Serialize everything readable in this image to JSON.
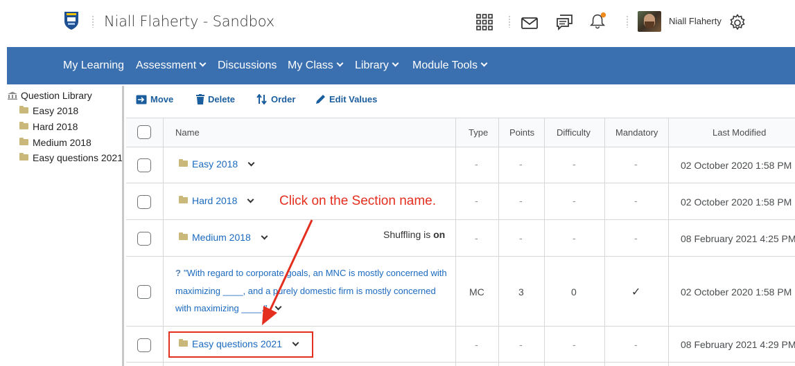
{
  "header": {
    "site_title": "Niall Flaherty - Sandbox",
    "user_name": "Niall Flaherty",
    "icons": [
      "app-grid-icon",
      "mail-icon",
      "chat-icon",
      "bell-icon",
      "gear-icon"
    ],
    "notification_color": "#f18a1d"
  },
  "nav": {
    "items": [
      {
        "label": "My Learning",
        "has_menu": false
      },
      {
        "label": "Assessment",
        "has_menu": true
      },
      {
        "label": "Discussions",
        "has_menu": false
      },
      {
        "label": "My Class",
        "has_menu": true
      },
      {
        "label": "Library",
        "has_menu": true
      },
      {
        "label": "Module Tools",
        "has_menu": true
      }
    ],
    "background_color": "#3a6fb0"
  },
  "tree": {
    "root": "Question Library",
    "items": [
      "Easy 2018",
      "Hard 2018",
      "Medium 2018",
      "Easy questions 2021"
    ]
  },
  "toolbar": {
    "move": "Move",
    "delete": "Delete",
    "order": "Order",
    "edit_values": "Edit Values"
  },
  "table": {
    "columns": [
      "Name",
      "Type",
      "Points",
      "Difficulty",
      "Mandatory",
      "Last Modified"
    ],
    "rows": [
      {
        "name": "Easy 2018",
        "kind": "section",
        "type": "-",
        "points": "-",
        "difficulty": "-",
        "mandatory": "-",
        "modified": "02 October 2020 1:58 PM"
      },
      {
        "name": "Hard 2018",
        "kind": "section",
        "type": "-",
        "points": "-",
        "difficulty": "-",
        "mandatory": "-",
        "modified": "02 October 2020 1:58 PM"
      },
      {
        "name": "Medium 2018",
        "kind": "section",
        "type": "-",
        "points": "-",
        "difficulty": "-",
        "mandatory": "-",
        "modified": "08 February 2021 4:25 PM",
        "shuffle_label": "Shuffling is",
        "shuffle_value": "on"
      },
      {
        "name": "\"With regard to corporate goals, an MNC is mostly concerned with maximizing ____, and a purely domestic firm is mostly concerned with maximizing ____.\"",
        "kind": "question",
        "type": "MC",
        "points": "3",
        "difficulty": "0",
        "mandatory": "✓",
        "modified": "02 October 2020 1:58 PM"
      },
      {
        "name": "Easy questions 2021",
        "kind": "section",
        "type": "-",
        "points": "-",
        "difficulty": "-",
        "mandatory": "-",
        "modified": "08 February 2021 4:29 PM"
      }
    ]
  },
  "annotation": {
    "text": "Click on the Section name.",
    "color": "#e42e1e"
  }
}
